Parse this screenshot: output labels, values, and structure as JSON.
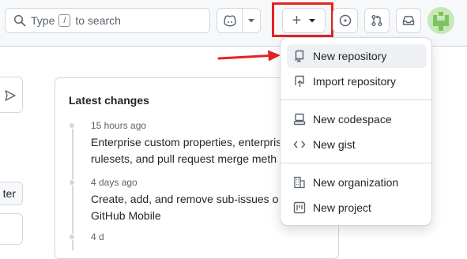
{
  "header": {
    "search": {
      "prefix": "Type",
      "key": "/",
      "suffix": "to search"
    },
    "create_symbol": "+"
  },
  "latest_changes": {
    "title": "Latest changes",
    "entries": [
      {
        "time": "15 hours ago",
        "line1": "Enterprise custom properties, enterpris",
        "line2": "rulesets, and pull request merge meth"
      },
      {
        "time": "4 days ago",
        "line1": "Create, add, and remove sub-issues o",
        "line2": "GitHub Mobile"
      },
      {
        "time": "4 d"
      }
    ]
  },
  "left_partial_button": "ter",
  "create_menu": {
    "items": [
      {
        "label": "New repository",
        "icon": "repo-icon"
      },
      {
        "label": "Import repository",
        "icon": "repo-push-icon"
      },
      {
        "label": "New codespace",
        "icon": "codespaces-icon"
      },
      {
        "label": "New gist",
        "icon": "code-icon"
      },
      {
        "label": "New organization",
        "icon": "organization-icon"
      },
      {
        "label": "New project",
        "icon": "project-icon"
      }
    ]
  },
  "colors": {
    "annotation_red": "#e52222",
    "menu_active_bg": "#eef0f3",
    "border": "#d1d9e0"
  }
}
